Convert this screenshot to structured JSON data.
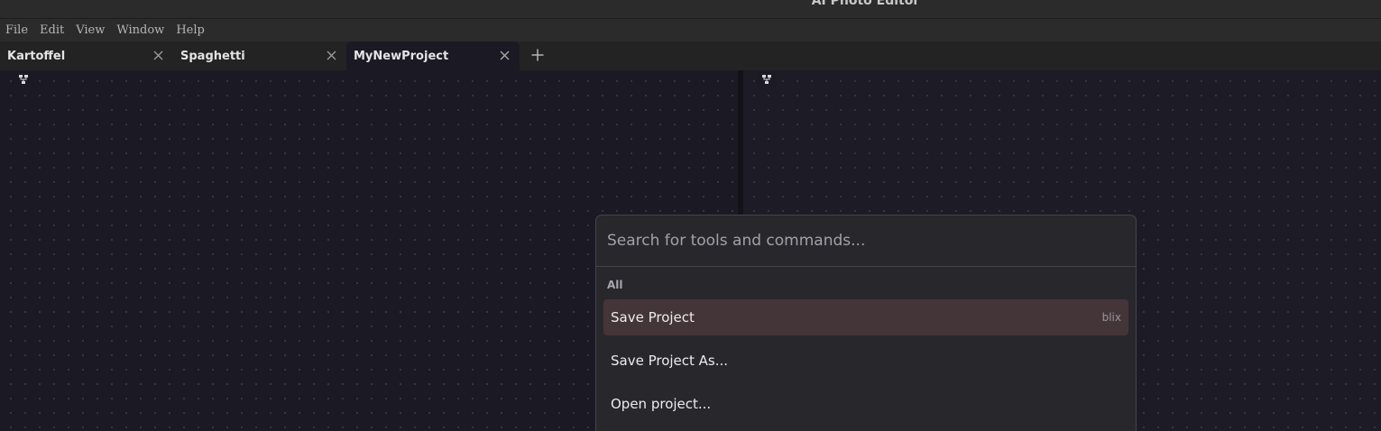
{
  "window": {
    "title": "AI Photo Editor"
  },
  "menu": [
    "File",
    "Edit",
    "View",
    "Window",
    "Help"
  ],
  "tabs": [
    {
      "label": "Kartoffel",
      "active": false
    },
    {
      "label": "Spaghetti",
      "active": false
    },
    {
      "label": "MyNewProject",
      "active": true
    }
  ],
  "palette": {
    "placeholder": "Search for tools and commands...",
    "group": "All",
    "items": [
      {
        "label": "Save Project",
        "shortcut": "blix",
        "highlighted": true
      },
      {
        "label": "Save Project As...",
        "shortcut": ""
      },
      {
        "label": "Open project...",
        "shortcut": ""
      }
    ]
  },
  "colors": {
    "canvas": "#1b1a24",
    "highlight": "#443539"
  },
  "icons": {
    "close": "close-icon",
    "add": "plus-icon",
    "node_graph": "node-graph-icon"
  }
}
